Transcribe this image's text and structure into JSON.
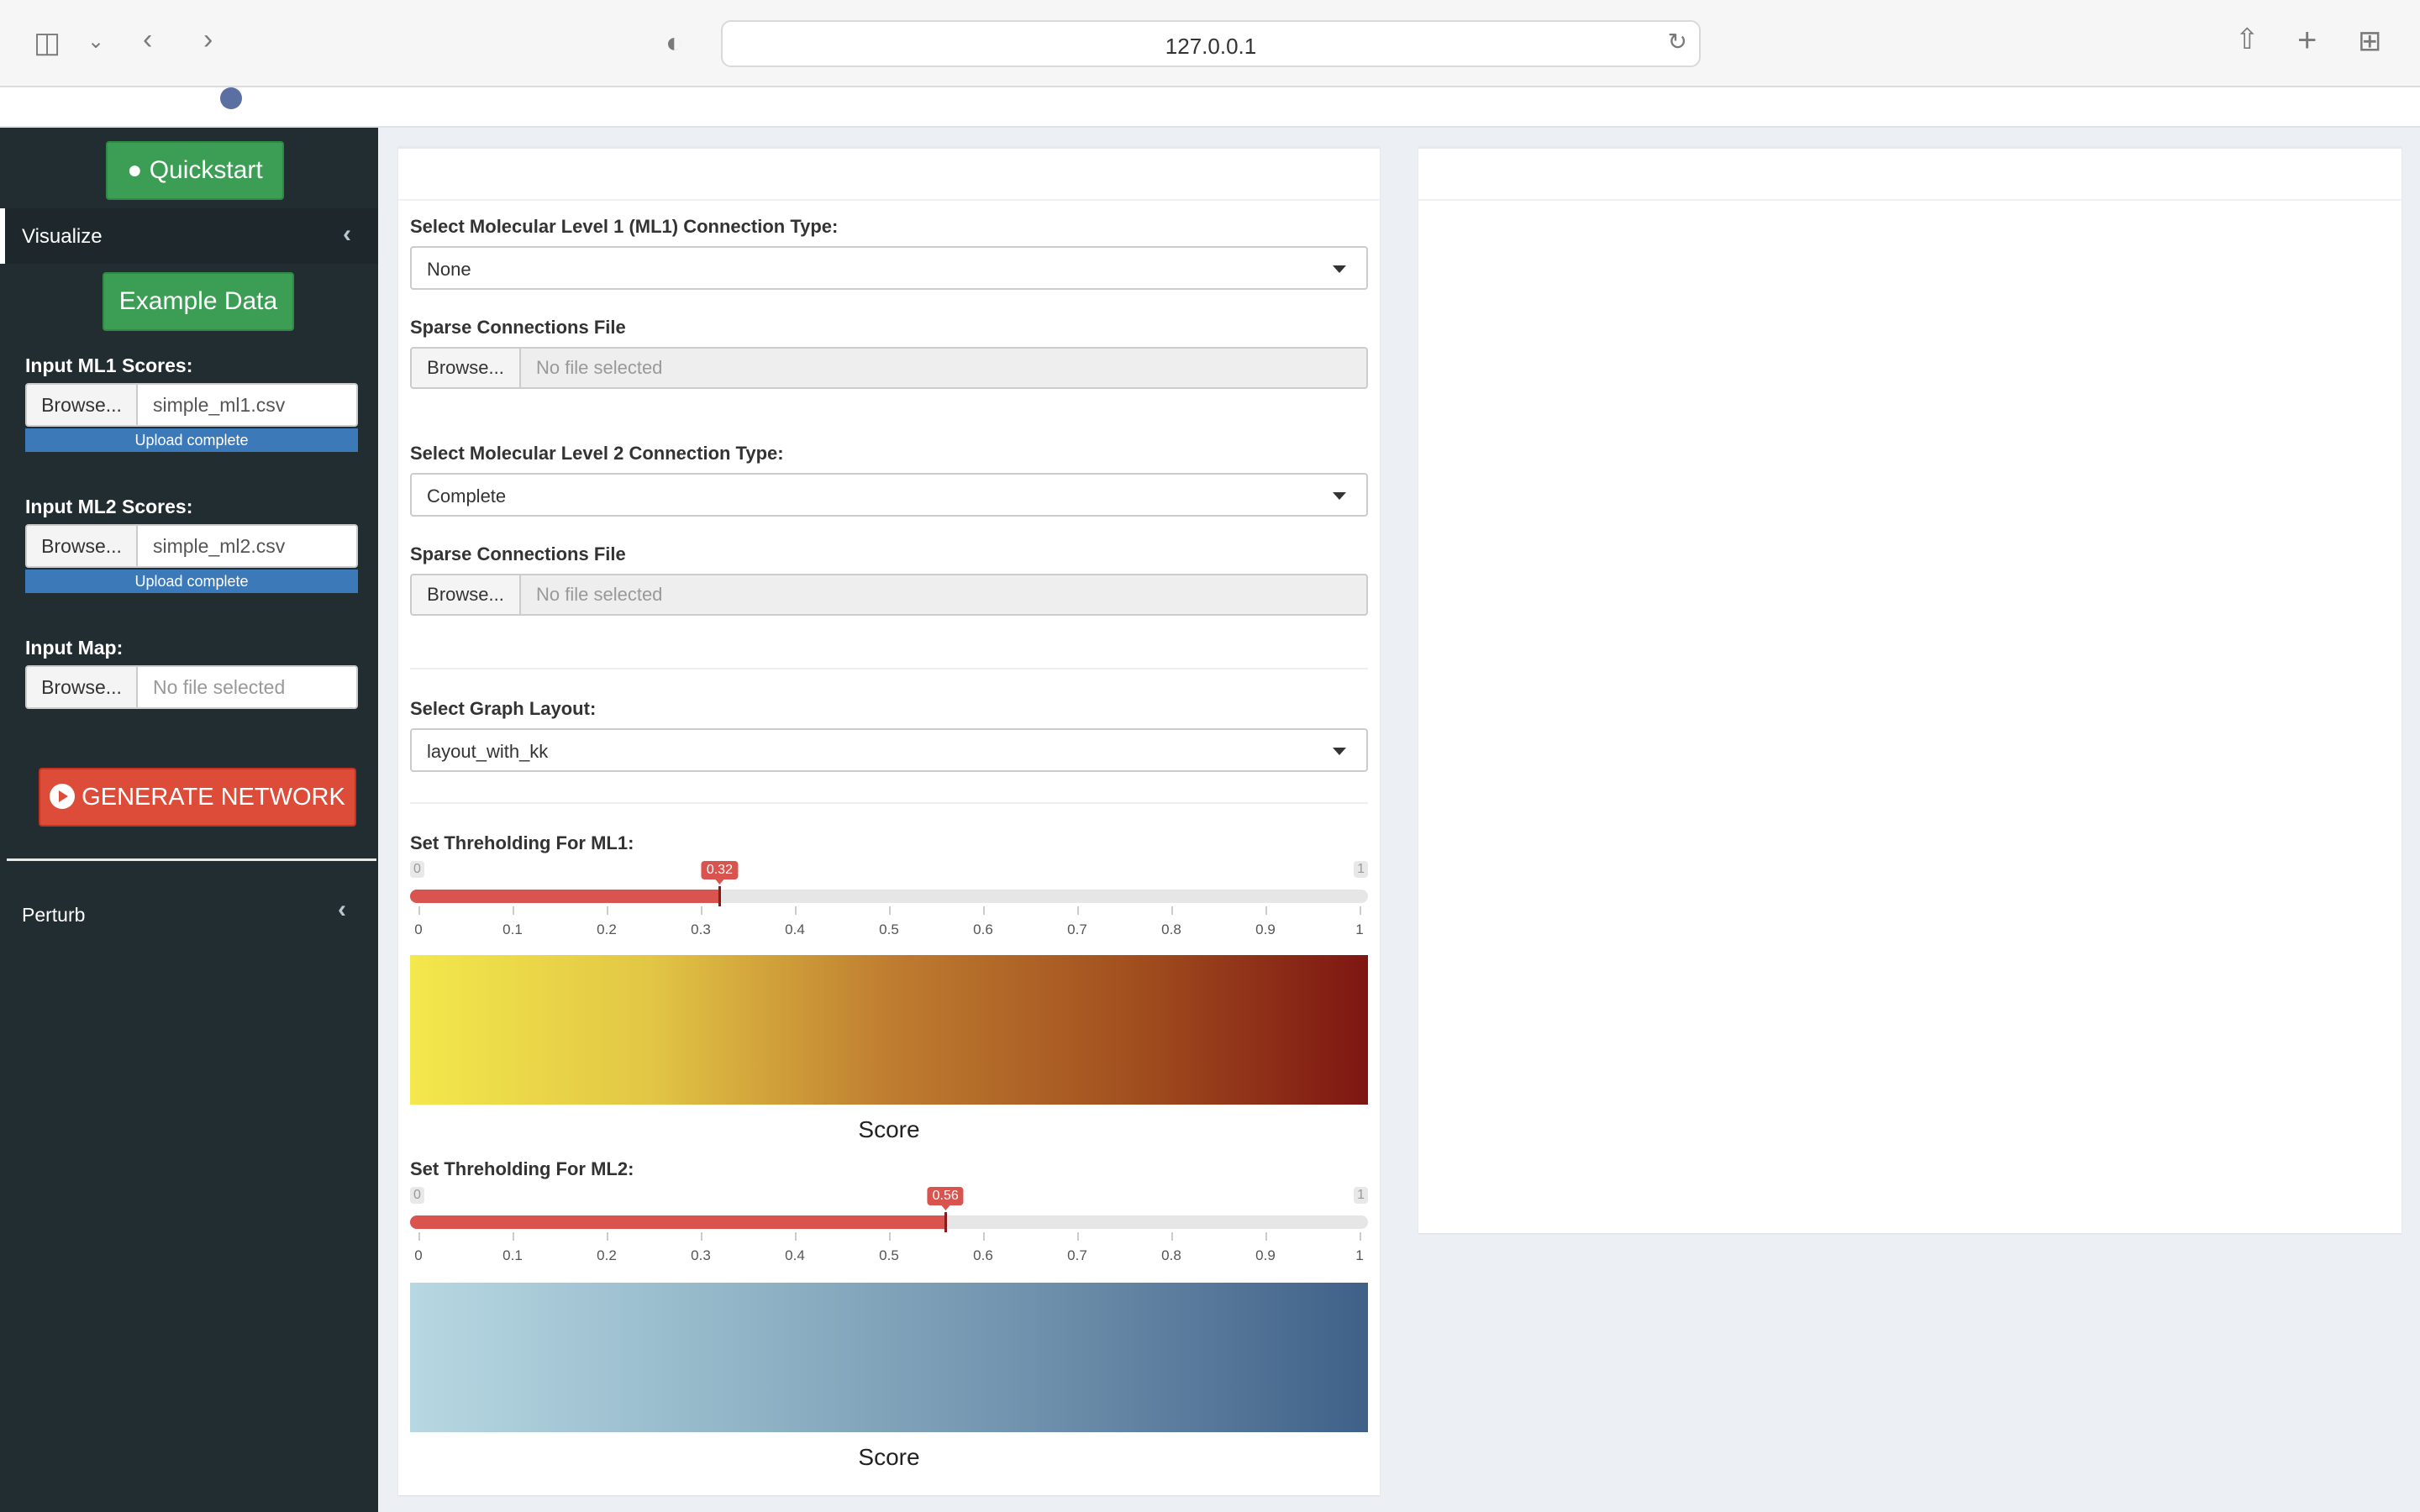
{
  "browser": {
    "url": "127.0.0.1"
  },
  "sidebar": {
    "quickstart_label": "Quickstart",
    "visualize_label": "Visualize",
    "example_data_label": "Example Data",
    "ml1": {
      "label": "Input ML1 Scores:",
      "browse": "Browse...",
      "file": "simple_ml1.csv",
      "status": "Upload complete"
    },
    "ml2": {
      "label": "Input ML2 Scores:",
      "browse": "Browse...",
      "file": "simple_ml2.csv",
      "status": "Upload complete"
    },
    "map": {
      "label": "Input Map:",
      "browse": "Browse...",
      "placeholder": "No file selected"
    },
    "generate_label": "GENERATE NETWORK",
    "perturb_label": "Perturb",
    "colors": {
      "bg": "#222d32",
      "green": "#3c9e55",
      "red": "#dd4b39",
      "upload": "#3c79b9"
    }
  },
  "main": {
    "ml1_conn": {
      "label": "Select Molecular Level 1 (ML1) Connection Type:",
      "value": "None"
    },
    "sparse1": {
      "label": "Sparse Connections File",
      "browse": "Browse...",
      "placeholder": "No file selected"
    },
    "ml2_conn": {
      "label": "Select Molecular Level 2 Connection Type:",
      "value": "Complete"
    },
    "sparse2": {
      "label": "Sparse Connections File",
      "browse": "Browse...",
      "placeholder": "No file selected"
    },
    "layout": {
      "label": "Select Graph Layout:",
      "value": "layout_with_kk"
    },
    "thresh1": {
      "label": "Set Threholding For ML1:",
      "min": "0",
      "max": "1",
      "value": "0.32",
      "ticks": [
        "0",
        "0.1",
        "0.2",
        "0.3",
        "0.4",
        "0.5",
        "0.6",
        "0.7",
        "0.8",
        "0.9",
        "1"
      ],
      "gradient": [
        "#f3e84c",
        "#e2c645",
        "#bf7d30",
        "#a2501f",
        "#7e1612"
      ],
      "legend_label": "Score"
    },
    "thresh2": {
      "label": "Set Threholding For ML2:",
      "min": "0",
      "max": "1",
      "value": "0.56",
      "ticks": [
        "0",
        "0.1",
        "0.2",
        "0.3",
        "0.4",
        "0.5",
        "0.6",
        "0.7",
        "0.8",
        "0.9",
        "1"
      ],
      "gradient": [
        "#b7d8e2",
        "#93b6c8",
        "#6e8fab",
        "#3f6188"
      ],
      "legend_label": "Score"
    }
  }
}
